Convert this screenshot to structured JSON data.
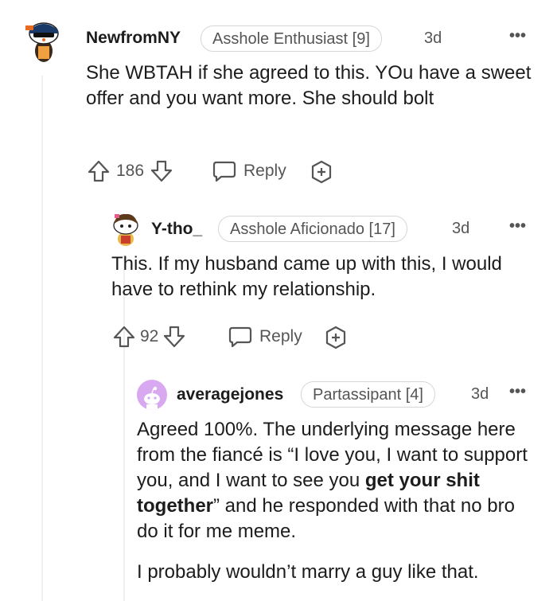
{
  "comments": [
    {
      "username": "NewfromNY",
      "flair": "Asshole Enthusiast [9]",
      "age": "3d",
      "more": "•••",
      "body": "She WBTAH if she agreed to this. YOu have a sweet offer and you want more. She should bolt",
      "votes": "186",
      "reply_label": "Reply"
    },
    {
      "username": "Y-tho_",
      "flair": "Asshole Aficionado [17]",
      "age": "3d",
      "more": "•••",
      "body": "This. If my husband came up with this, I would have to rethink my relationship.",
      "votes": "92",
      "reply_label": "Reply"
    },
    {
      "username": "averagejones",
      "flair": "Partassipant [4]",
      "age": "3d",
      "more": "•••",
      "body_part1": "Agreed 100%. The underlying message here from the fiancé is “I love you, I want to support you, and I want to see you ",
      "body_bold": "get your shit together",
      "body_part2": "” and he responded with that no bro do it for me meme.",
      "body_para2": "I probably wouldn’t marry a guy like that."
    }
  ],
  "colors": {
    "thread_line": "#edeff1",
    "meta_text": "#555555",
    "flair_border": "#d4d7d9",
    "avatar3_bg": "#d8a8f0"
  }
}
